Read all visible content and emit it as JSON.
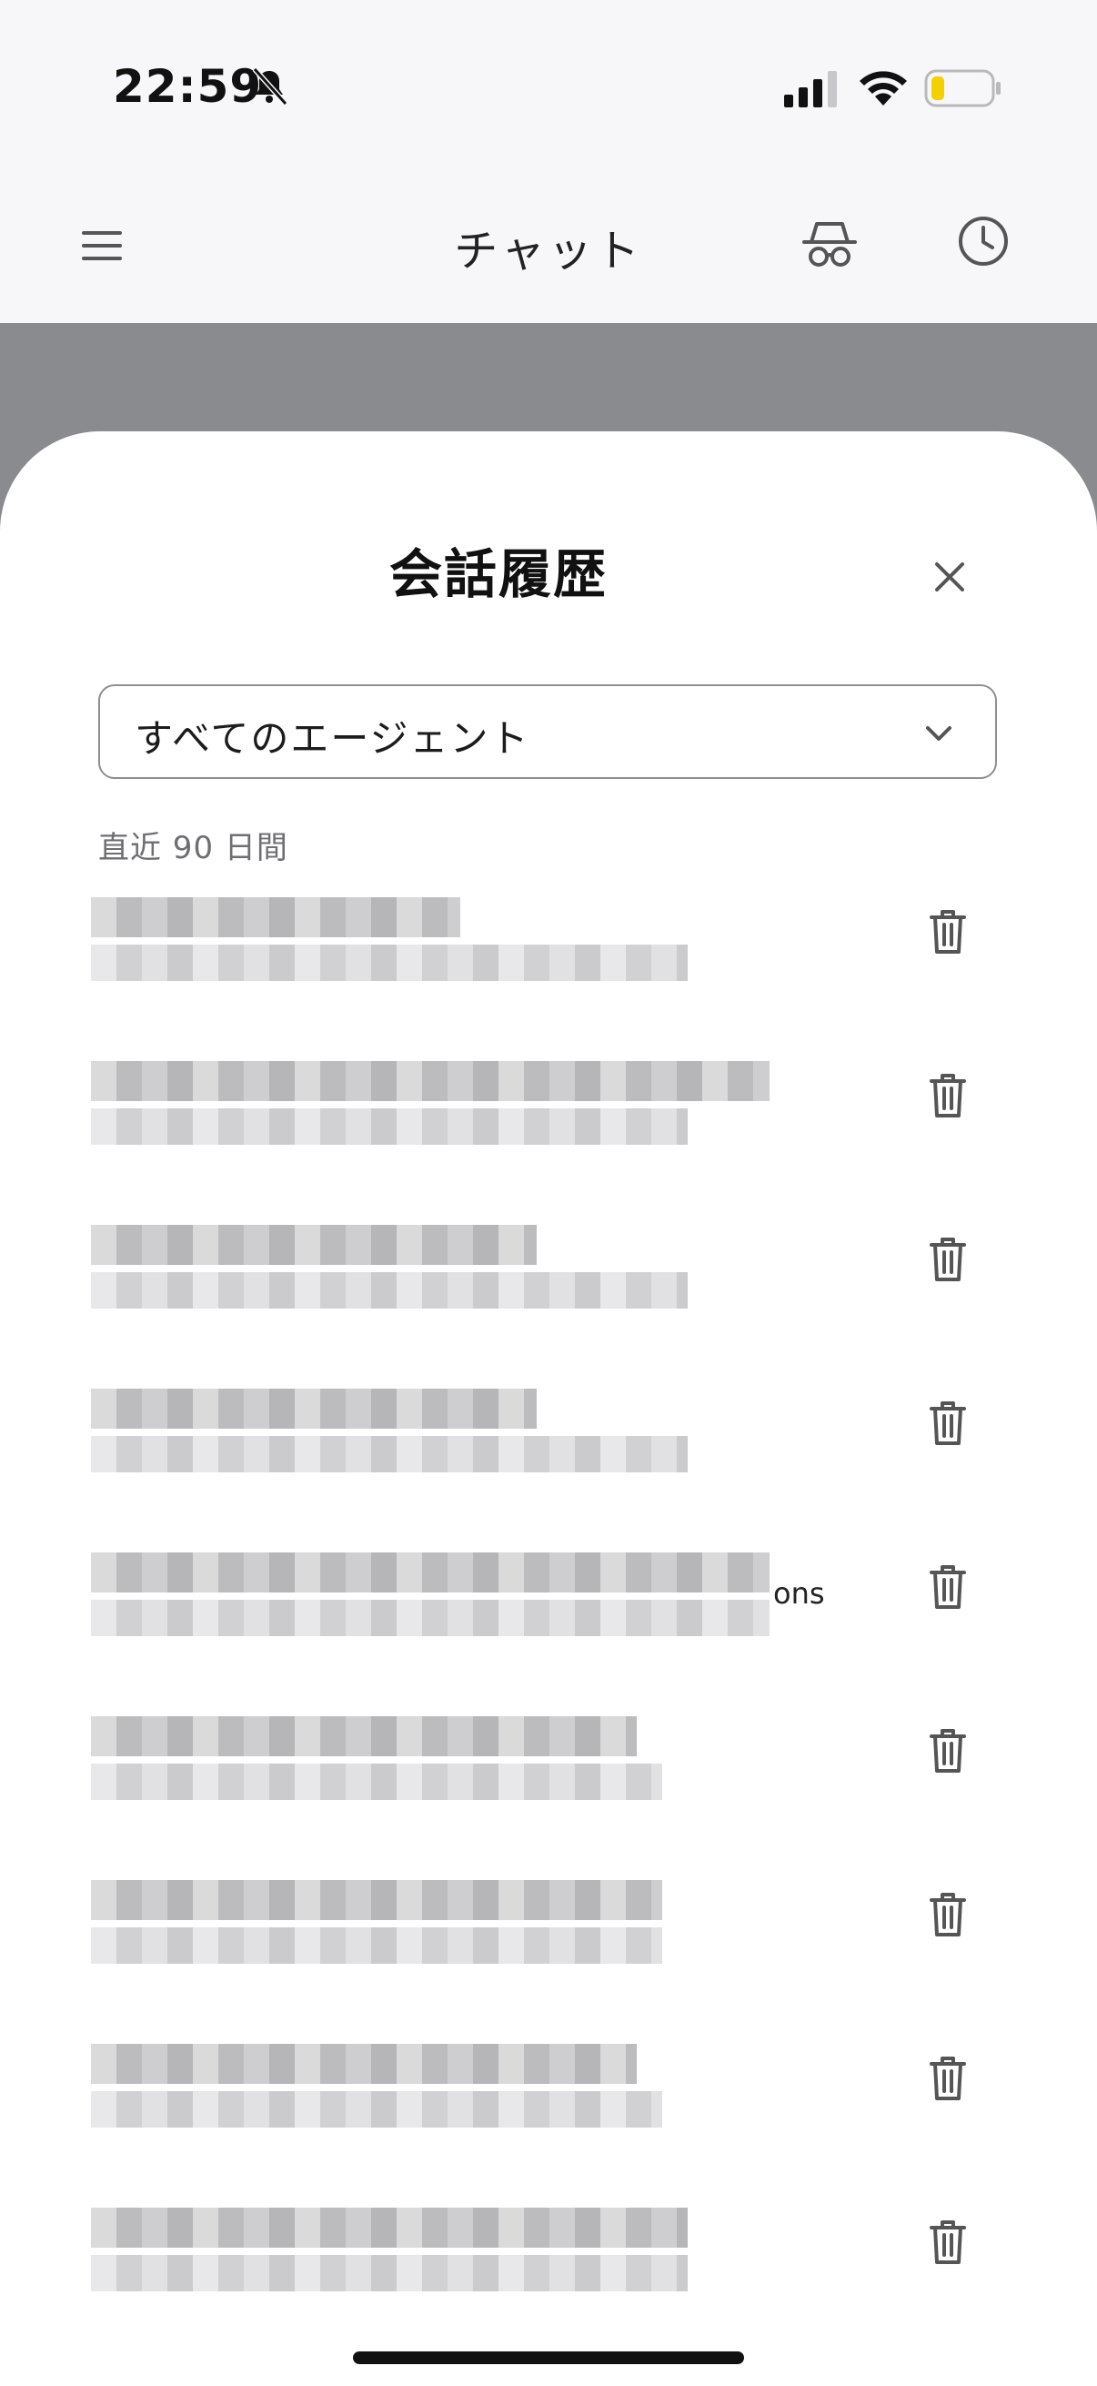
{
  "status_bar": {
    "time": "22:59",
    "battery_color": "#f5d000"
  },
  "header": {
    "title": "チャット"
  },
  "sheet": {
    "title": "会話履歴",
    "agent_filter": {
      "selected": "すべてのエージェント"
    },
    "section_label": "直近 90 日間",
    "conversations": [
      {
        "title": "",
        "subtitle": ""
      },
      {
        "title": "",
        "subtitle": ""
      },
      {
        "title": "",
        "subtitle": ""
      },
      {
        "title": "",
        "subtitle": ""
      },
      {
        "title": "",
        "subtitle": "",
        "visible_fragment": "ons"
      },
      {
        "title": "",
        "subtitle": ""
      },
      {
        "title": "",
        "subtitle": ""
      },
      {
        "title": "",
        "subtitle": ""
      },
      {
        "title": "",
        "subtitle": ""
      }
    ]
  },
  "icons": {
    "menu": "hamburger-icon",
    "incognito": "incognito-icon",
    "history": "clock-icon",
    "close": "close-icon",
    "dropdown": "chevron-down-icon",
    "delete": "trash-icon"
  }
}
